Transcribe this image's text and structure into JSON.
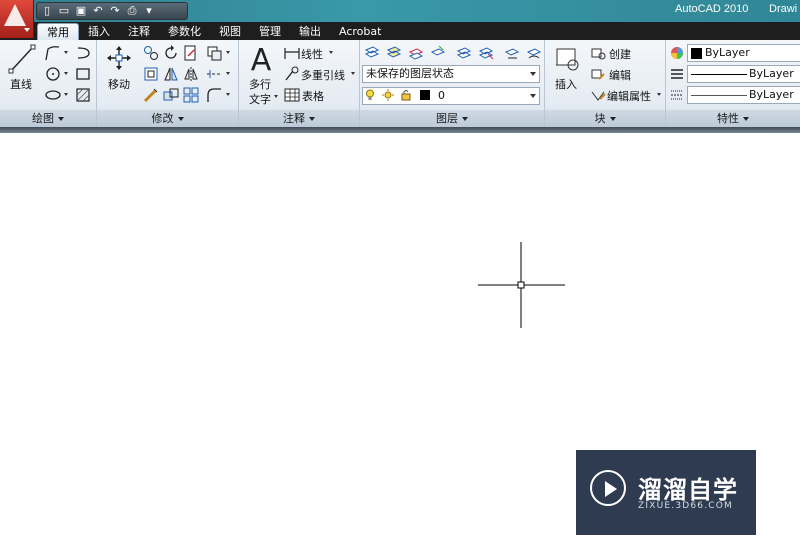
{
  "title_bar": {
    "app_name": "AutoCAD 2010",
    "document_name": "Drawi",
    "qat_icons": [
      "new-file-icon",
      "open-folder-icon",
      "save-icon",
      "undo-icon",
      "redo-icon",
      "plot-icon",
      "customize-icon"
    ]
  },
  "tabs": [
    {
      "label": "常用",
      "active": true
    },
    {
      "label": "插入"
    },
    {
      "label": "注释"
    },
    {
      "label": "参数化"
    },
    {
      "label": "视图"
    },
    {
      "label": "管理"
    },
    {
      "label": "输出"
    },
    {
      "label": "Acrobat"
    }
  ],
  "panels": {
    "draw": {
      "title": "绘图",
      "line_label": "直线"
    },
    "modify": {
      "title": "修改",
      "move_label": "移动"
    },
    "annotation": {
      "title": "注释",
      "mtext_label_1": "多行",
      "mtext_label_2": "文字",
      "linear_label": "线性",
      "mleader_label": "多重引线",
      "table_label": "表格"
    },
    "layers": {
      "title": "图层",
      "layer_state": "未保存的图层状态",
      "current_layer": "0"
    },
    "block": {
      "title": "块",
      "insert_label": "插入",
      "create_label": "创建",
      "edit_label": "编辑",
      "edit_attr_label": "编辑属性"
    },
    "properties": {
      "title": "特性",
      "color": "ByLayer",
      "linetype": "ByLayer",
      "lineweight": "ByLayer"
    }
  },
  "colors": {
    "title_bar": "#3a98a8",
    "app_button": "#c0342a",
    "tab_bar": "#1e1e1e",
    "ribbon_bg": "#e4ebf2",
    "watermark_bg": "#2e3b50"
  },
  "watermark": {
    "title": "溜溜自学",
    "url": "ZIXUE.3D66.COM"
  }
}
